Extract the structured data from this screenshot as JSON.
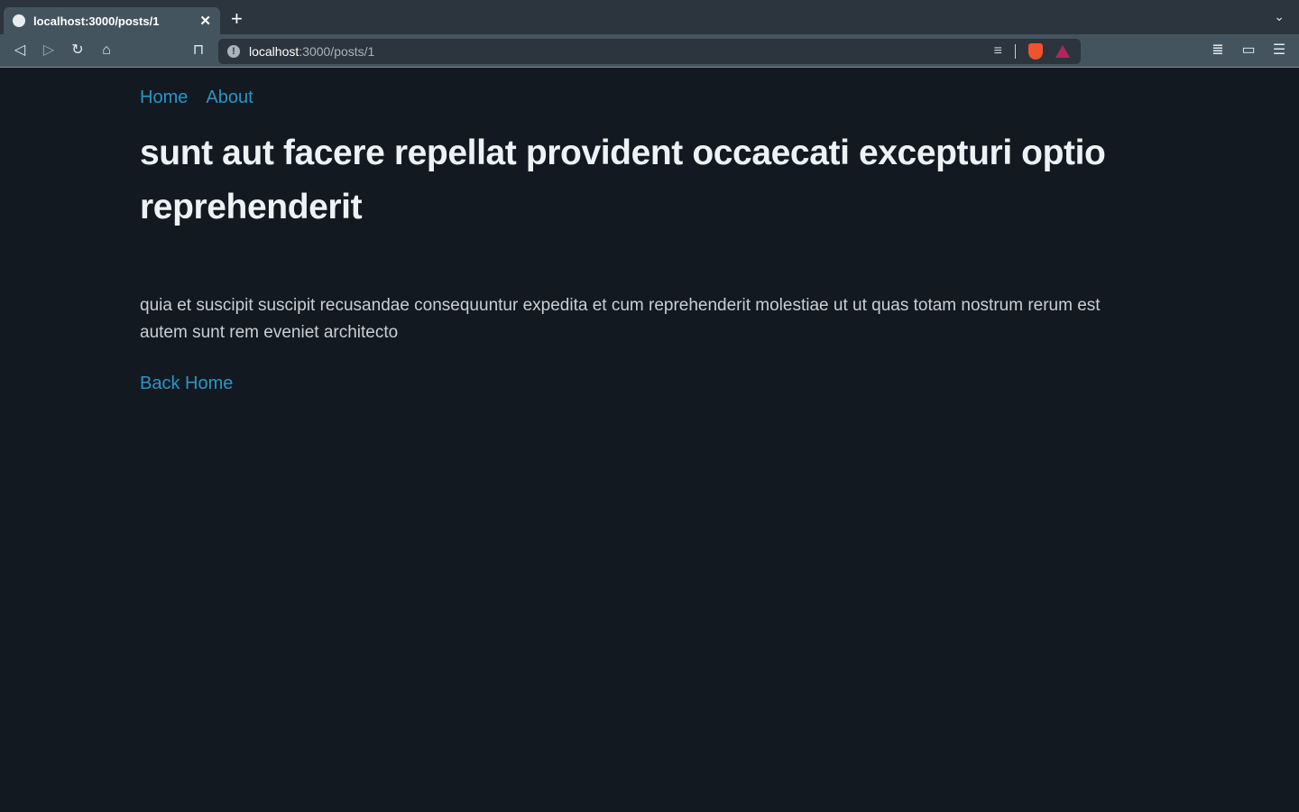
{
  "browser": {
    "tab_title": "localhost:3000/posts/1",
    "url_host": "localhost",
    "url_path": ":3000/posts/1"
  },
  "nav": {
    "home": "Home",
    "about": "About"
  },
  "post": {
    "title": "sunt aut facere repellat provident occaecati excepturi optio reprehenderit",
    "body": "quia et suscipit suscipit recusandae consequuntur expedita et cum reprehenderit molestiae ut ut quas totam nostrum rerum est autem sunt rem eveniet architecto",
    "back_link": "Back Home"
  },
  "colors": {
    "background": "#131920",
    "link": "#2a95c5",
    "heading": "#eef2f5"
  }
}
